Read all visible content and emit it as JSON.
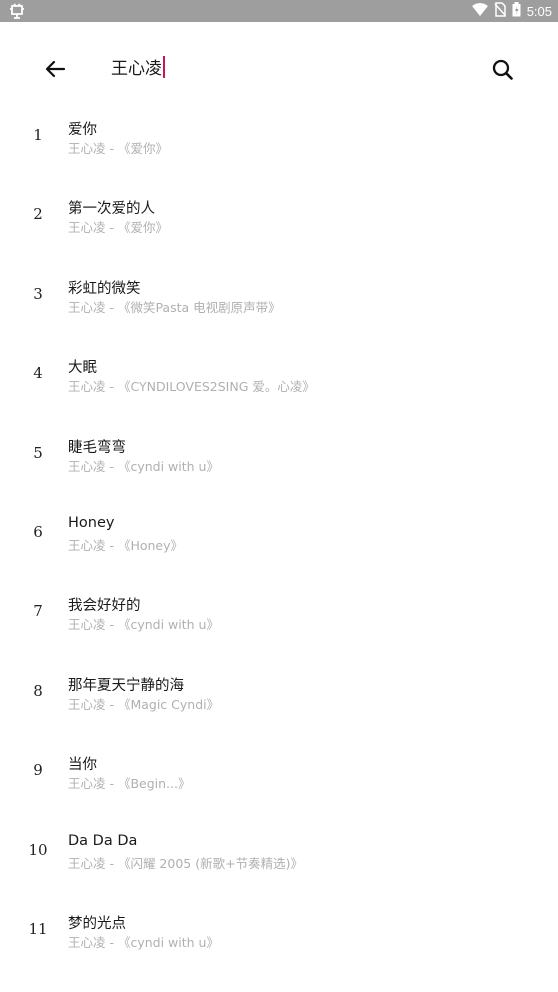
{
  "status_bar": {
    "left_icon": "bug-icon",
    "right_icons": [
      "wifi-icon",
      "no-sim-icon",
      "battery-icon"
    ],
    "time": "5:05"
  },
  "search": {
    "query": "王心凌",
    "back_icon": "arrow-back-icon",
    "search_icon": "search-icon",
    "caret_color": "#c2185b"
  },
  "songs": [
    {
      "num": "1",
      "title": "爱你",
      "sub": "王心凌 - 《爱你》"
    },
    {
      "num": "2",
      "title": "第一次爱的人",
      "sub": "王心凌 - 《爱你》"
    },
    {
      "num": "3",
      "title": "彩虹的微笑",
      "sub": "王心凌 - 《微笑Pasta 电视剧原声带》"
    },
    {
      "num": "4",
      "title": "大眠",
      "sub": "王心凌 - 《CYNDILOVES2SING 爱。心凌》"
    },
    {
      "num": "5",
      "title": "睫毛弯弯",
      "sub": "王心凌 - 《cyndi with u》"
    },
    {
      "num": "6",
      "title": "Honey",
      "sub": "王心凌 - 《Honey》"
    },
    {
      "num": "7",
      "title": "我会好好的",
      "sub": "王心凌 - 《cyndi with u》"
    },
    {
      "num": "8",
      "title": "那年夏天宁静的海",
      "sub": "王心凌 - 《Magic Cyndi》"
    },
    {
      "num": "9",
      "title": "当你",
      "sub": "王心凌 - 《Begin...》"
    },
    {
      "num": "10",
      "title": "Da Da Da",
      "sub": "王心凌 - 《闪耀 2005 (新歌+节奏精选)》"
    },
    {
      "num": "11",
      "title": "梦的光点",
      "sub": "王心凌 - 《cyndi with u》"
    }
  ]
}
